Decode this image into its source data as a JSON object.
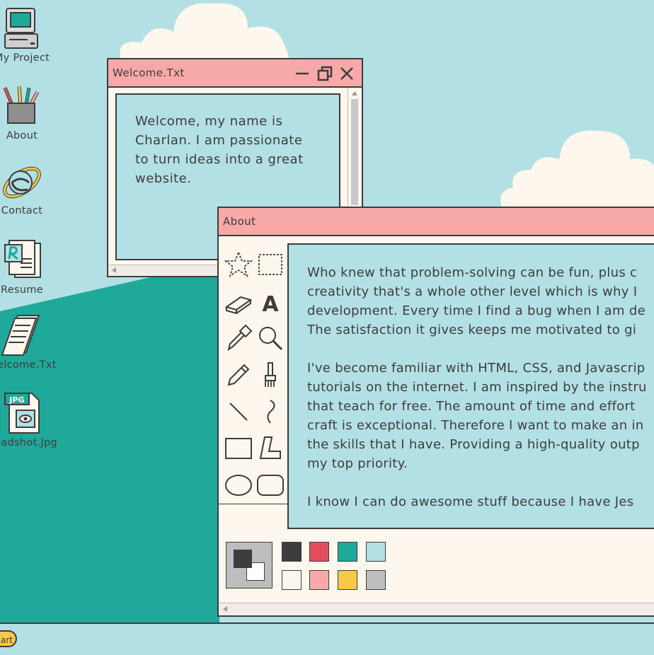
{
  "desktop": {
    "background_color": "#b3e0e4",
    "ground_color": "#1fa99a",
    "icons": [
      {
        "label": "My Project",
        "icon": "computer-icon"
      },
      {
        "label": "About",
        "icon": "pencil-cup-icon"
      },
      {
        "label": "Contact",
        "icon": "internet-explorer-icon"
      },
      {
        "label": "Resume",
        "icon": "resume-document-icon"
      },
      {
        "label": "Welcome.Txt",
        "icon": "notepad-icon"
      },
      {
        "label": "Headshot.Jpg",
        "icon": "jpg-file-icon",
        "badge": "JPG"
      }
    ]
  },
  "welcome_window": {
    "title": "Welcome.Txt",
    "text": "Welcome, my name is Charlan. I am passionate to turn ideas into a great website.",
    "lines": [
      "Welcome, my name is",
      "Charlan. I am passionate",
      "to turn ideas into a great",
      "website."
    ]
  },
  "about_window": {
    "title": "About",
    "paragraphs": [
      [
        "Who knew that problem-solving can be fun, plus c",
        "creativity that's a whole other level which is why I",
        "development. Every time I find a bug when I am de",
        "The satisfaction it gives keeps me motivated to gi"
      ],
      [
        "I've become familiar with HTML, CSS, and Javascrip",
        "tutorials on the internet. I am inspired by the instru",
        "that teach for free. The amount of time and effort",
        "craft is exceptional. Therefore I want to make an in",
        "the skills that I have. Providing a high-quality outp",
        "my top priority."
      ],
      [
        "I know I can do awesome stuff because I have Jes"
      ]
    ],
    "tools": [
      "free-select-icon",
      "rect-select-icon",
      "eraser-icon",
      "text-icon",
      "eyedropper-icon",
      "magnifier-icon",
      "pencil-icon",
      "brush-icon",
      "line-icon",
      "curve-icon",
      "rectangle-icon",
      "polygon-icon",
      "ellipse-icon",
      "rounded-rect-icon"
    ],
    "palette": {
      "foreground": "#3d3d3d",
      "background": "#ffffff",
      "colors": [
        "#3d3d3d",
        "#e04e5e",
        "#1fa99a",
        "#b3e0e4",
        "#fdf7ed",
        "#f7a9a8",
        "#f7c948",
        "#bdbdbd"
      ]
    }
  },
  "taskbar": {
    "start_label": "Start",
    "start_visible": "art"
  }
}
